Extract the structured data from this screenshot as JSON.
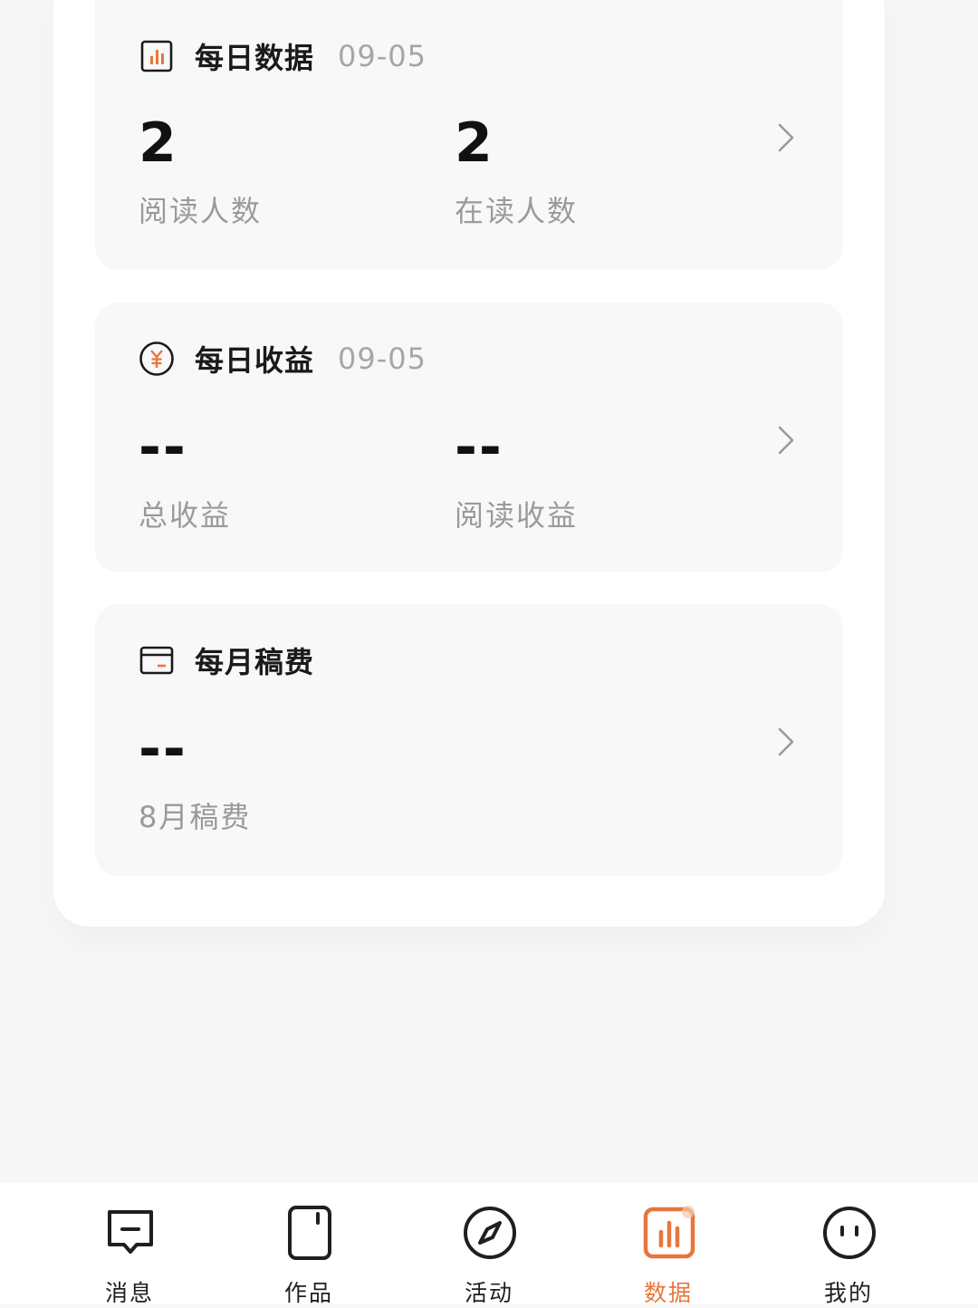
{
  "colors": {
    "accent": "#e8763b",
    "primary_text": "#111111",
    "secondary_text": "#9a9a9a",
    "card_bg": "#f8f8f8"
  },
  "cards": {
    "daily_data": {
      "icon": "bar-chart-icon",
      "title": "每日数据",
      "date": "09-05",
      "stats": [
        {
          "value": "2",
          "label": "阅读人数"
        },
        {
          "value": "2",
          "label": "在读人数"
        }
      ]
    },
    "daily_income": {
      "icon": "yuan-coin-icon",
      "title": "每日收益",
      "date": "09-05",
      "stats": [
        {
          "value": "--",
          "label": "总收益"
        },
        {
          "value": "--",
          "label": "阅读收益"
        }
      ]
    },
    "monthly_fee": {
      "icon": "wallet-card-icon",
      "title": "每月稿费",
      "stats": [
        {
          "value": "--",
          "label": "8月稿费"
        }
      ]
    }
  },
  "tabbar": {
    "active": "数据",
    "items": [
      {
        "label": "消息",
        "icon": "message-icon"
      },
      {
        "label": "作品",
        "icon": "works-icon"
      },
      {
        "label": "活动",
        "icon": "compass-icon"
      },
      {
        "label": "数据",
        "icon": "data-chart-icon"
      },
      {
        "label": "我的",
        "icon": "profile-face-icon"
      }
    ]
  }
}
